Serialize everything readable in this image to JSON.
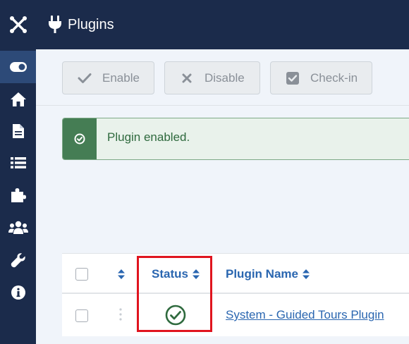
{
  "header": {
    "title": "Plugins",
    "icon": "plug-icon"
  },
  "sidebar": {
    "items": [
      {
        "name": "toggle-menu",
        "icon": "toggle-icon",
        "active": true
      },
      {
        "name": "home",
        "icon": "home-icon"
      },
      {
        "name": "content",
        "icon": "file-icon"
      },
      {
        "name": "menus",
        "icon": "list-icon"
      },
      {
        "name": "components",
        "icon": "puzzle-icon"
      },
      {
        "name": "users",
        "icon": "users-icon"
      },
      {
        "name": "system",
        "icon": "wrench-icon"
      },
      {
        "name": "help",
        "icon": "info-icon"
      }
    ]
  },
  "toolbar": {
    "enable_label": "Enable",
    "disable_label": "Disable",
    "checkin_label": "Check-in"
  },
  "alert": {
    "message": "Plugin enabled."
  },
  "table": {
    "columns": {
      "status": "Status",
      "plugin_name": "Plugin Name"
    },
    "rows": [
      {
        "status": "enabled",
        "plugin_name": "System - Guided Tours Plugin"
      }
    ]
  },
  "colors": {
    "navy": "#1b2b4b",
    "active_sidebar": "#2d4a78",
    "link_blue": "#2a66b0",
    "success_green": "#457d54",
    "highlight_red": "#e0141e"
  }
}
